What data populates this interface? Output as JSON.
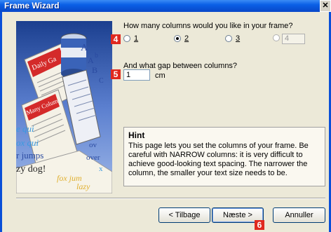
{
  "window": {
    "title": "Frame Wizard",
    "close_glyph": "✕"
  },
  "markers": {
    "m4": "4",
    "m5": "5",
    "m6": "6"
  },
  "columns": {
    "question": "How many columns would you like in your frame?",
    "options": [
      {
        "label": "1",
        "checked": false
      },
      {
        "label": "2",
        "checked": true
      },
      {
        "label": "3",
        "checked": false
      }
    ],
    "spin_value": "4"
  },
  "gap": {
    "question": "And what gap between columns?",
    "value": "1",
    "unit": "cm"
  },
  "hint": {
    "title": "Hint",
    "text": "This page lets you set the columns of your frame. Be careful with NARROW columns: it is very difficult to achieve good-looking text spacing. The narrower the column, the smaller your text size needs to be."
  },
  "illustration": {
    "paper_top": "Daily Ga",
    "paper_mid": "Many Colum",
    "scatter": [
      "e qui",
      "ox qui",
      "r jumps",
      "zy dog!",
      "fox jum",
      "lazy",
      "b",
      "A",
      "A",
      "B",
      "C",
      "over",
      "ov",
      "x"
    ]
  },
  "buttons": {
    "back": "< Tilbage",
    "back_underline": "T",
    "next": "Næste >",
    "next_underline": "N",
    "cancel": "Annuller"
  }
}
